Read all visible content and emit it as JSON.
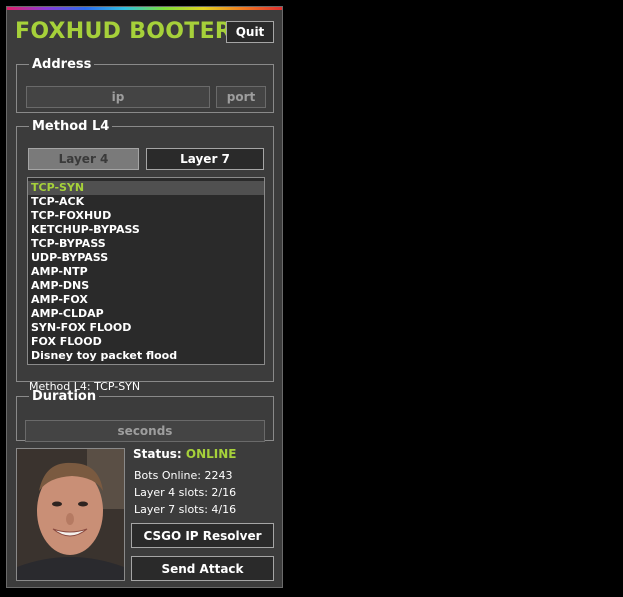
{
  "app": {
    "title": "FOXHUD BOOTER",
    "quit_label": "Quit"
  },
  "address": {
    "legend": "Address",
    "ip_placeholder": "ip",
    "port_placeholder": "port"
  },
  "method": {
    "legend": "Method L4",
    "tabs": [
      {
        "label": "Layer 4"
      },
      {
        "label": "Layer 7"
      }
    ],
    "items": [
      "TCP-SYN",
      "TCP-ACK",
      "TCP-FOXHUD",
      "KETCHUP-BYPASS",
      "TCP-BYPASS",
      "UDP-BYPASS",
      "AMP-NTP",
      "AMP-DNS",
      "AMP-FOX",
      "AMP-CLDAP",
      "SYN-FOX FLOOD",
      "FOX FLOOD",
      "Disney toy packet flood"
    ],
    "selected_index": 0,
    "status_text": "Method L4: TCP-SYN"
  },
  "duration": {
    "legend": "Duration",
    "placeholder": "seconds"
  },
  "status": {
    "label": "Status:",
    "value": "ONLINE",
    "bots_online": "Bots Online: 2243",
    "layer4_slots": "Layer 4 slots: 2/16",
    "layer7_slots": "Layer 7 slots: 4/16"
  },
  "actions": {
    "resolver_label": "CSGO IP Resolver",
    "attack_label": "Send Attack"
  },
  "colors": {
    "accent": "#a6d13a",
    "panel": "#3c3c3c",
    "background": "#000000"
  }
}
